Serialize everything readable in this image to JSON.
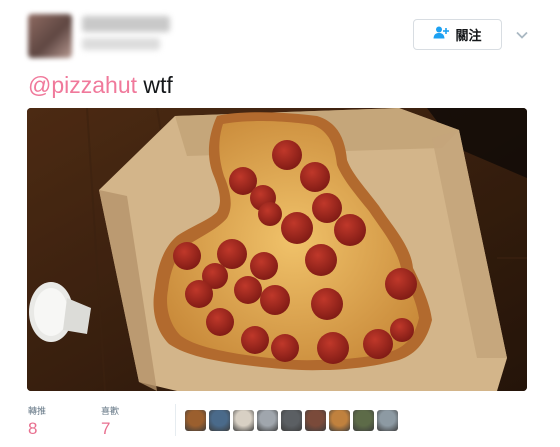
{
  "author": {
    "name": "",
    "handle": ""
  },
  "follow_button": {
    "label": "關注",
    "icon": "add-person-icon"
  },
  "tweet": {
    "mention": "@pizzahut",
    "text": "wtf"
  },
  "stats": [
    {
      "key": "轉推",
      "value": "8"
    },
    {
      "key": "喜歡",
      "value": "7"
    }
  ],
  "likers": [
    "#9b5f2e",
    "#4a6a8a",
    "#d8d0c4",
    "#a0a6ad",
    "#5b5f63",
    "#7a4a3a",
    "#c0813e",
    "#5d6b48",
    "#8d9aa3"
  ],
  "colors": {
    "mention": "#f0799b",
    "stat_value": "#e86f8f",
    "accent": "#1da1f2"
  }
}
